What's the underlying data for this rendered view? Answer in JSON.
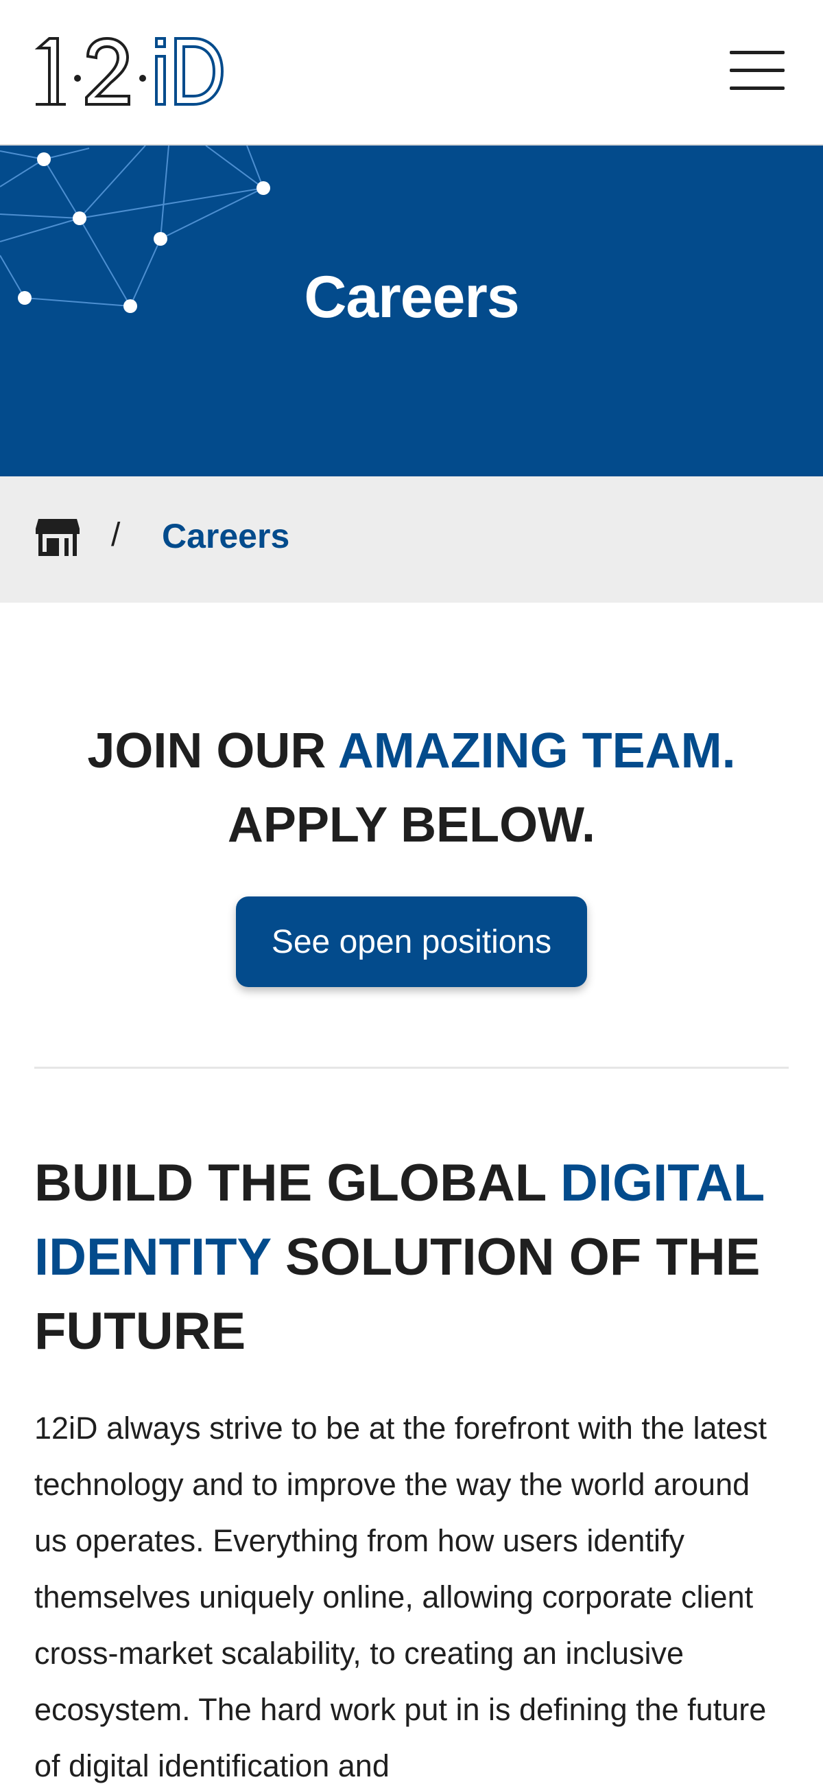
{
  "header": {
    "logo_text": "12iD",
    "menu_icon": "hamburger-menu-icon"
  },
  "hero": {
    "title": "Careers",
    "decoration_icon": "network-graph-icon"
  },
  "breadcrumb": {
    "home_icon": "home-icon",
    "separator": "/",
    "current": "Careers"
  },
  "join": {
    "heading_part1": "JOIN OUR ",
    "heading_accent": "AMAZING TEAM.",
    "heading_part2": "APPLY BELOW.",
    "button_label": "See open positions"
  },
  "build": {
    "heading_part1": "BUILD THE GLOBAL ",
    "heading_accent": "DIGITAL IDENTITY",
    "heading_part2": " SOLUTION OF THE FUTURE",
    "body": "12iD always strive to be at the forefront with the latest technology and to improve the way the world around us operates. Everything from how users identify themselves uniquely online, allowing corporate client cross-market scalability, to creating an inclusive ecosystem. The hard work put in is defining the future of digital identification and"
  },
  "colors": {
    "brand_blue": "#034b8c",
    "text_dark": "#1f1f1f",
    "breadcrumb_bg": "#ededed",
    "white": "#ffffff"
  }
}
